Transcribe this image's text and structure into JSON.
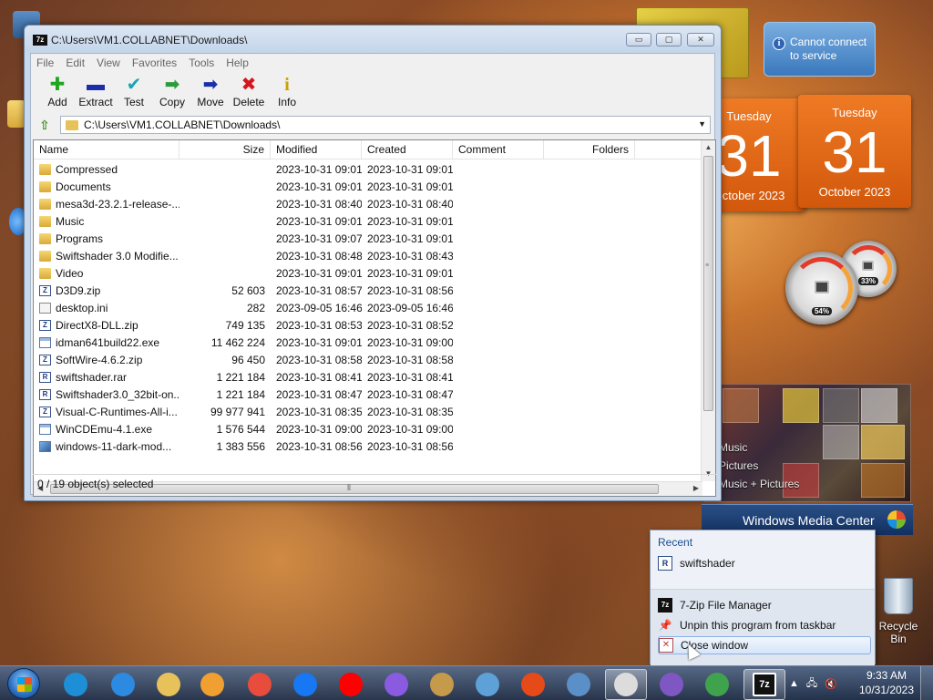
{
  "window": {
    "title": "C:\\Users\\VM1.COLLABNET\\Downloads\\",
    "app_icon": "7z",
    "controls": {
      "minimize": "▭",
      "maximize": "▢",
      "close": "✕"
    }
  },
  "menu": [
    "File",
    "Edit",
    "View",
    "Favorites",
    "Tools",
    "Help"
  ],
  "toolbar": [
    {
      "label": "Add",
      "icon": "plus-icon",
      "glyph": "✚",
      "color": "#1fa51f"
    },
    {
      "label": "Extract",
      "icon": "minus-icon",
      "glyph": "▬",
      "color": "#1b2fa8"
    },
    {
      "label": "Test",
      "icon": "check-icon",
      "glyph": "✔",
      "color": "#1aa5b5"
    },
    {
      "label": "Copy",
      "icon": "arrow-right-green-icon",
      "glyph": "➡",
      "color": "#2b9b3b"
    },
    {
      "label": "Move",
      "icon": "arrow-right-blue-icon",
      "glyph": "➡",
      "color": "#1b2fa8"
    },
    {
      "label": "Delete",
      "icon": "x-icon",
      "glyph": "✖",
      "color": "#d4161b"
    },
    {
      "label": "Info",
      "icon": "info-icon",
      "glyph": "i",
      "color": "#c9a100"
    }
  ],
  "address": {
    "path": "C:\\Users\\VM1.COLLABNET\\Downloads\\",
    "dropdown": "▼",
    "up": "⇧"
  },
  "columns": [
    "Name",
    "Size",
    "Modified",
    "Created",
    "Comment",
    "Folders"
  ],
  "files": [
    {
      "name": "Compressed",
      "size": "",
      "modified": "2023-10-31 09:01",
      "created": "2023-10-31 09:01",
      "type": "folder"
    },
    {
      "name": "Documents",
      "size": "",
      "modified": "2023-10-31 09:01",
      "created": "2023-10-31 09:01",
      "type": "folder"
    },
    {
      "name": "mesa3d-23.2.1-release-...",
      "size": "",
      "modified": "2023-10-31 08:40",
      "created": "2023-10-31 08:40",
      "type": "folder"
    },
    {
      "name": "Music",
      "size": "",
      "modified": "2023-10-31 09:01",
      "created": "2023-10-31 09:01",
      "type": "folder"
    },
    {
      "name": "Programs",
      "size": "",
      "modified": "2023-10-31 09:07",
      "created": "2023-10-31 09:01",
      "type": "folder"
    },
    {
      "name": "Swiftshader 3.0 Modifie...",
      "size": "",
      "modified": "2023-10-31 08:48",
      "created": "2023-10-31 08:43",
      "type": "folder"
    },
    {
      "name": "Video",
      "size": "",
      "modified": "2023-10-31 09:01",
      "created": "2023-10-31 09:01",
      "type": "folder"
    },
    {
      "name": "D3D9.zip",
      "size": "52 603",
      "modified": "2023-10-31 08:57",
      "created": "2023-10-31 08:56",
      "type": "zip"
    },
    {
      "name": "desktop.ini",
      "size": "282",
      "modified": "2023-09-05 16:46",
      "created": "2023-09-05 16:46",
      "type": "ini"
    },
    {
      "name": "DirectX8-DLL.zip",
      "size": "749 135",
      "modified": "2023-10-31 08:53",
      "created": "2023-10-31 08:52",
      "type": "zip"
    },
    {
      "name": "idman641build22.exe",
      "size": "11 462 224",
      "modified": "2023-10-31 09:01",
      "created": "2023-10-31 09:00",
      "type": "exe"
    },
    {
      "name": "SoftWire-4.6.2.zip",
      "size": "96 450",
      "modified": "2023-10-31 08:58",
      "created": "2023-10-31 08:58",
      "type": "zip"
    },
    {
      "name": "swiftshader.rar",
      "size": "1 221 184",
      "modified": "2023-10-31 08:41",
      "created": "2023-10-31 08:41",
      "type": "rar"
    },
    {
      "name": "Swiftshader3.0_32bit-on...",
      "size": "1 221 184",
      "modified": "2023-10-31 08:47",
      "created": "2023-10-31 08:47",
      "type": "rar"
    },
    {
      "name": "Visual-C-Runtimes-All-i...",
      "size": "99 977 941",
      "modified": "2023-10-31 08:35",
      "created": "2023-10-31 08:35",
      "type": "zip"
    },
    {
      "name": "WinCDEmu-4.1.exe",
      "size": "1 576 544",
      "modified": "2023-10-31 09:00",
      "created": "2023-10-31 09:00",
      "type": "exe"
    },
    {
      "name": "windows-11-dark-mod...",
      "size": "1 383 556",
      "modified": "2023-10-31 08:56",
      "created": "2023-10-31 08:56",
      "type": "img"
    }
  ],
  "status": "0 / 19 object(s) selected",
  "gadgets": {
    "error_text": "Cannot connect to service",
    "calendar_left": {
      "day": "Tuesday",
      "num": "31",
      "month": "October 2023"
    },
    "calendar_right": {
      "day": "Tuesday",
      "num": "31",
      "month": "October 2023"
    },
    "cpu_meter": "54%",
    "mem_meter": "33%",
    "media_labels": [
      "Music",
      "Pictures",
      "Music + Pictures"
    ],
    "wmc_title": "Windows Media Center"
  },
  "desktop": {
    "recycle_bin": "Recycle Bin"
  },
  "jumplist": {
    "recent_header": "Recent",
    "recent_items": [
      "swiftshader"
    ],
    "tasks": [
      "7-Zip File Manager",
      "Unpin this program from taskbar",
      "Close window"
    ]
  },
  "taskbar": {
    "time": "9:33 AM",
    "date": "10/31/2023",
    "apps": [
      {
        "name": "edge",
        "color": "#1e8fd6"
      },
      {
        "name": "internet-explorer",
        "color": "#2c8ae0"
      },
      {
        "name": "file-explorer",
        "color": "#e7c25a"
      },
      {
        "name": "media-player",
        "color": "#f0a030"
      },
      {
        "name": "chrome",
        "color": "#e74c3c"
      },
      {
        "name": "facebook",
        "color": "#1877f2"
      },
      {
        "name": "youtube",
        "color": "#ff0000"
      },
      {
        "name": "copilot",
        "color": "#8a5ae0"
      },
      {
        "name": "winrar",
        "color": "#c59a4a"
      },
      {
        "name": "control-panel",
        "color": "#5ea0d8"
      },
      {
        "name": "office",
        "color": "#e64a19"
      },
      {
        "name": "computer",
        "color": "#5b8fc8"
      },
      {
        "name": "screen-app",
        "color": "#dcdcdc"
      },
      {
        "name": "media-center",
        "color": "#7e57c2"
      },
      {
        "name": "download-manager",
        "color": "#3fa34d"
      },
      {
        "name": "7zip",
        "color": "#111111"
      }
    ]
  }
}
